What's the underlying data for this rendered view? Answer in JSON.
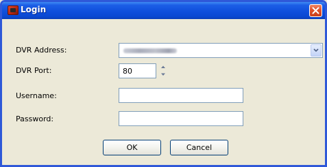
{
  "window": {
    "title": "Login",
    "icon": "dvr-app-icon",
    "close_icon": "close-icon"
  },
  "form": {
    "address_label": "DVR Address:",
    "port_label": "DVR Port:",
    "port_value": "80",
    "username_label": "Username:",
    "username_value": "",
    "password_label": "Password:",
    "password_value": ""
  },
  "buttons": {
    "ok_label": "OK",
    "cancel_label": "Cancel"
  },
  "colors": {
    "title_bar": "#0a48d2",
    "close_button": "#e0502a",
    "window_bg": "#ece9d8",
    "field_border": "#7f9db9"
  }
}
